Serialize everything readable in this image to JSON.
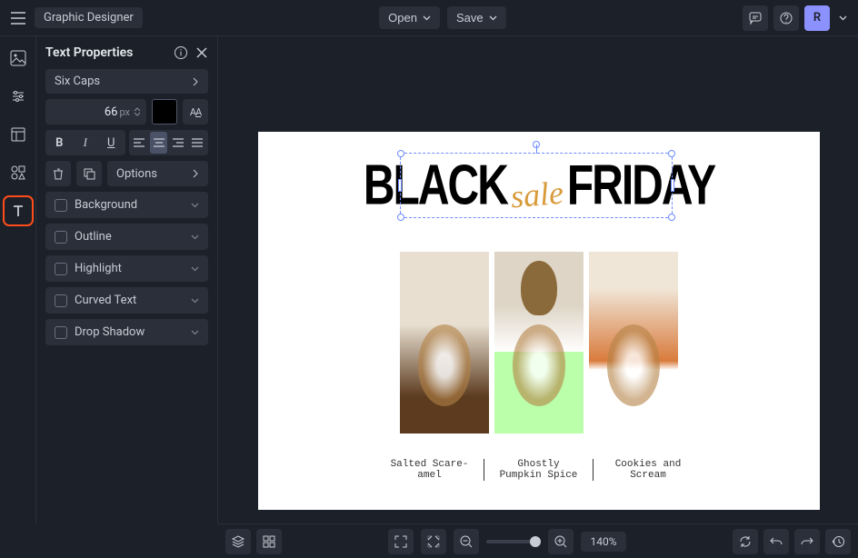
{
  "header": {
    "app_title": "Graphic Designer",
    "open_label": "Open",
    "save_label": "Save",
    "avatar_letter": "R"
  },
  "panel": {
    "title": "Text Properties",
    "font_family": "Six Caps",
    "font_size": "66",
    "font_size_unit": "px",
    "color": "#000000",
    "options_label": "Options",
    "sections": {
      "background": "Background",
      "outline": "Outline",
      "highlight": "Highlight",
      "curved": "Curved Text",
      "shadow": "Drop Shadow"
    }
  },
  "canvas": {
    "headline_black": "BLACK",
    "headline_sale": "sale",
    "headline_friday": "FRIDAY",
    "captions": {
      "c1": "Salted Scare-amel",
      "c2": "Ghostly Pumpkin Spice",
      "c3": "Cookies and Scream"
    }
  },
  "bottombar": {
    "zoom_label": "140%"
  }
}
